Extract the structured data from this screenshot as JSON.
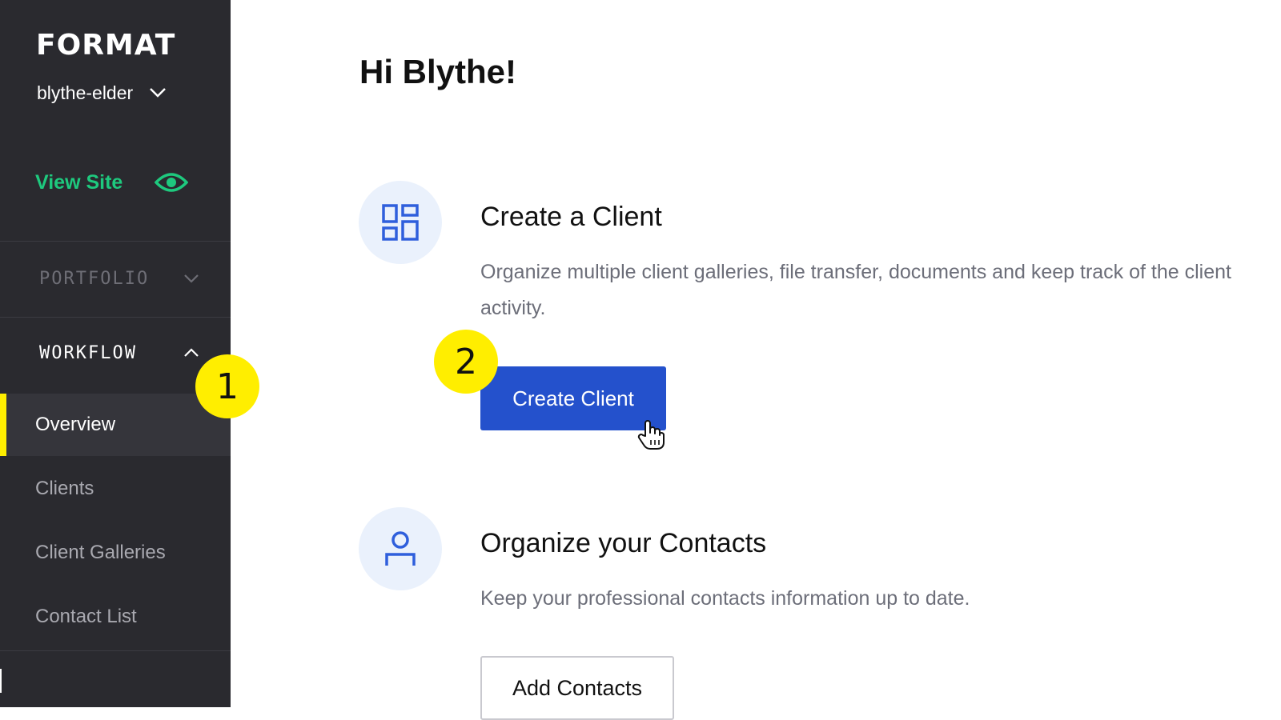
{
  "sidebar": {
    "logo": "FORMAT",
    "account": "blythe-elder",
    "view_site": "View Site",
    "sections": {
      "portfolio": "PORTFOLIO",
      "workflow": "WORKFLOW"
    },
    "items": [
      {
        "label": "Overview",
        "active": true
      },
      {
        "label": "Clients"
      },
      {
        "label": "Client Galleries"
      },
      {
        "label": "Contact List"
      }
    ]
  },
  "main": {
    "greeting": "Hi Blythe!",
    "cards": [
      {
        "title": "Create a Client",
        "description": "Organize multiple client galleries, file transfer, documents and keep track of the client activity.",
        "button": "Create Client",
        "icon": "dashboard-icon"
      },
      {
        "title": "Organize your Contacts",
        "description": "Keep your professional contacts information up to date.",
        "button": "Add Contacts",
        "icon": "user-icon"
      }
    ]
  },
  "annotations": {
    "badge_1": "1",
    "badge_2": "2"
  },
  "colors": {
    "sidebar_bg": "#2a2a2f",
    "accent_green": "#1ec97e",
    "primary_blue": "#2451cc",
    "highlight_yellow": "#ffee00"
  }
}
